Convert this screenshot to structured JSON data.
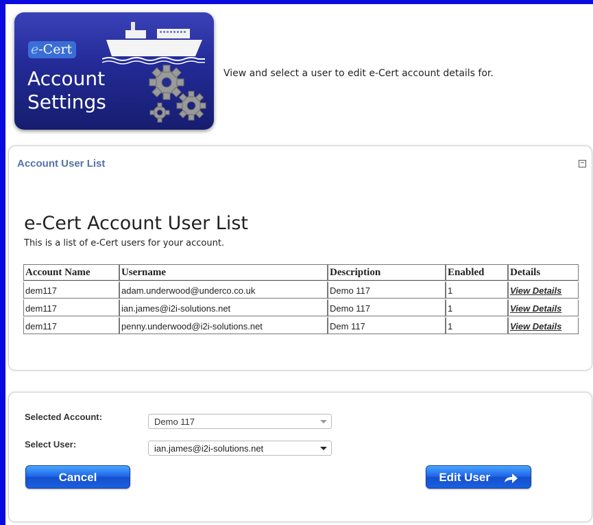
{
  "logo": {
    "badge_e": "e",
    "badge_text": "-Cert",
    "title_line1": "Account",
    "title_line2": "Settings"
  },
  "intro_text": "View and select a user to edit e-Cert account details for.",
  "user_list_panel": {
    "header": "Account User List",
    "collapse_symbol": "−",
    "title": "e-Cert Account User List",
    "subtitle": "This is a list of e-Cert users for your account.",
    "columns": [
      "Account Name",
      "Username",
      "Description",
      "Enabled",
      "Details"
    ],
    "rows": [
      {
        "account_name": "dem117",
        "username": "adam.underwood@underco.co.uk",
        "description": "Demo 117",
        "enabled": "1",
        "details": "View Details"
      },
      {
        "account_name": "dem117",
        "username": "ian.james@i2i-solutions.net",
        "description": "Demo 117",
        "enabled": "1",
        "details": "View Details"
      },
      {
        "account_name": "dem117",
        "username": "penny.underwood@i2i-solutions.net",
        "description": "Dem 117",
        "enabled": "1",
        "details": "View Details"
      }
    ]
  },
  "selection_panel": {
    "selected_account_label": "Selected Account:",
    "selected_account_value": "Demo 117",
    "select_user_label": "Select User:",
    "select_user_value": "ian.james@i2i-solutions.net",
    "cancel_label": "Cancel",
    "edit_user_label": "Edit User"
  },
  "colors": {
    "frame": "#0a0adf",
    "panel_header": "#5372a8",
    "button": "#1e64e8"
  }
}
